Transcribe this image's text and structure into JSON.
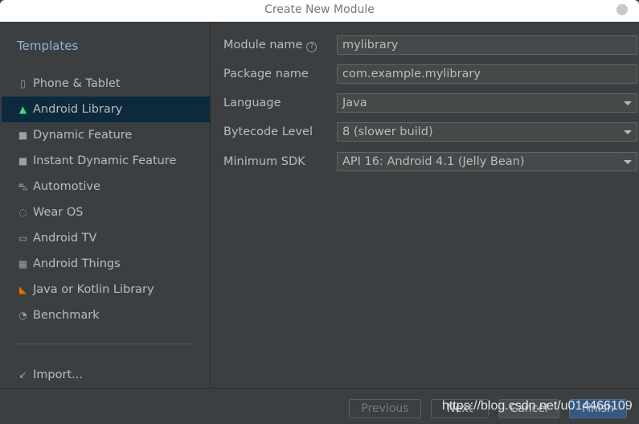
{
  "window": {
    "title": "Create New Module"
  },
  "sidebar": {
    "heading": "Templates",
    "items": [
      {
        "label": "Phone & Tablet",
        "icon": "phone-tablet-icon"
      },
      {
        "label": "Android Library",
        "icon": "android-icon",
        "selected": true
      },
      {
        "label": "Dynamic Feature",
        "icon": "dynamic-feature-folder-icon"
      },
      {
        "label": "Instant Dynamic Feature",
        "icon": "instant-feature-folder-icon"
      },
      {
        "label": "Automotive",
        "icon": "car-icon"
      },
      {
        "label": "Wear OS",
        "icon": "watch-icon"
      },
      {
        "label": "Android TV",
        "icon": "tv-icon"
      },
      {
        "label": "Android Things",
        "icon": "things-chip-icon"
      },
      {
        "label": "Java or Kotlin Library",
        "icon": "kotlin-icon"
      },
      {
        "label": "Benchmark",
        "icon": "benchmark-gauge-icon"
      }
    ],
    "import_label": "Import..."
  },
  "form": {
    "module_name": {
      "label": "Module name",
      "value": "mylibrary"
    },
    "package_name": {
      "label": "Package name",
      "value": "com.example.mylibrary"
    },
    "language": {
      "label": "Language",
      "value": "Java"
    },
    "bytecode": {
      "label": "Bytecode Level",
      "value": "8 (slower build)"
    },
    "min_sdk": {
      "label": "Minimum SDK",
      "value": "API 16: Android 4.1 (Jelly Bean)"
    }
  },
  "footer": {
    "previous": "Previous",
    "next": "Next",
    "cancel": "Cancel",
    "finish": "Finish"
  },
  "watermark": "https://blog.csdn.net/u014466109",
  "colors": {
    "selection": "#0d293e",
    "accent": "#365880",
    "android": "#3ddc84"
  }
}
